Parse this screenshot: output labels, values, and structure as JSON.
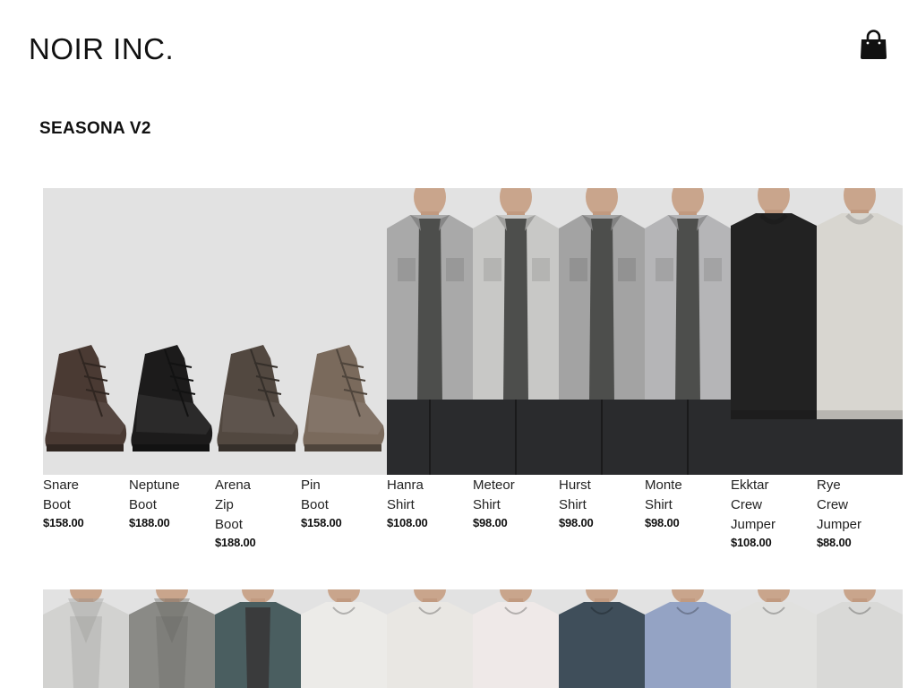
{
  "header": {
    "logo": "NOIR INC.",
    "cart_icon": "shopping-bag-icon"
  },
  "collection": {
    "title": "SEASONA V2"
  },
  "colors": {
    "thumb_background": "#e2e2e2",
    "text": "#111111"
  },
  "products_row1": [
    {
      "name": "Snare Boot",
      "price": "$158.00",
      "kind": "boot",
      "color": "#4a3a33"
    },
    {
      "name": "Neptune Boot",
      "price": "$188.00",
      "kind": "boot",
      "color": "#1c1b1b"
    },
    {
      "name": "Arena Zip Boot",
      "price": "$188.00",
      "kind": "boot",
      "color": "#524840"
    },
    {
      "name": "Pin Boot",
      "price": "$158.00",
      "kind": "boot",
      "color": "#7a6a5c"
    },
    {
      "name": "Hanra Shirt",
      "price": "$108.00",
      "kind": "shirt",
      "color": "#a9a9a9"
    },
    {
      "name": "Meteor Shirt",
      "price": "$98.00",
      "kind": "shirt",
      "color": "#c8c8c6"
    },
    {
      "name": "Hurst Shirt",
      "price": "$98.00",
      "kind": "shirt",
      "color": "#a3a3a3"
    },
    {
      "name": "Monte Shirt",
      "price": "$98.00",
      "kind": "shirt",
      "color": "#b5b5b7"
    },
    {
      "name": "Ekktar Crew Jumper",
      "price": "$108.00",
      "kind": "jumper",
      "color": "#222222"
    },
    {
      "name": "Rye Crew Jumper",
      "price": "$88.00",
      "kind": "jumper",
      "color": "#d8d6d0"
    }
  ],
  "products_row2": [
    {
      "kind": "hoodie",
      "color": "#d2d2d0"
    },
    {
      "kind": "hoodie",
      "color": "#8a8a86"
    },
    {
      "kind": "cardigan",
      "color": "#4a5e60"
    },
    {
      "kind": "tee",
      "color": "#ecebe8"
    },
    {
      "kind": "tee",
      "color": "#e9e7e3"
    },
    {
      "kind": "tee",
      "color": "#efe9e8"
    },
    {
      "kind": "tee",
      "color": "#3f4e5a"
    },
    {
      "kind": "tee",
      "color": "#94a3c4"
    },
    {
      "kind": "tee",
      "color": "#e1e1df"
    },
    {
      "kind": "tee",
      "color": "#d9d9d7"
    }
  ]
}
